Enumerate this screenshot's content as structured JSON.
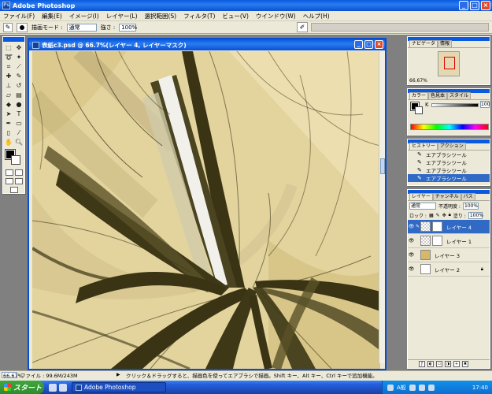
{
  "window": {
    "title": "Adobe Photoshop"
  },
  "menu": [
    "ファイル(F)",
    "編集(E)",
    "イメージ(I)",
    "レイヤー(L)",
    "選択範囲(S)",
    "フィルタ(T)",
    "ビュー(V)",
    "ウインドウ(W)",
    "ヘルプ(H)"
  ],
  "options": {
    "mode_label": "描画モード :",
    "mode_value": "通常",
    "strength_label": "強さ :",
    "strength_value": "100%"
  },
  "document": {
    "title": "表紙c3.psd @ 66.7%(レイヤー 4, レイヤーマスク)"
  },
  "navigator": {
    "tabs": [
      "ナビゲータ",
      "情報"
    ],
    "zoom": "66.67%"
  },
  "color": {
    "tabs": [
      "カラー",
      "色見本",
      "スタイル"
    ],
    "channel_label": "K",
    "k_value": "100"
  },
  "history": {
    "tabs": [
      "ヒストリー",
      "アクション"
    ],
    "items": [
      {
        "label": "エアブラシツール"
      },
      {
        "label": "エアブラシツール"
      },
      {
        "label": "エアブラシツール"
      },
      {
        "label": "エアブラシツール"
      }
    ]
  },
  "layers": {
    "tabs": [
      "レイヤー",
      "チャンネル",
      "パス"
    ],
    "blend": "通常",
    "opacity_label": "不透明度 :",
    "opacity": "100%",
    "lock_label": "ロック :",
    "fill_label": "塗り :",
    "fill": "100%",
    "items": [
      {
        "name": "レイヤー 4"
      },
      {
        "name": "レイヤー 1"
      },
      {
        "name": "レイヤー 3"
      },
      {
        "name": "レイヤー 2"
      }
    ]
  },
  "status": {
    "zoom": "66.67%",
    "file": "ファイル : 99.6M/243M",
    "hint": "クリック＆ドラッグすると、描画色を使ってエアブラシで描画。Shift キー、Alt キー、Ctrl キーで追加機能。"
  },
  "taskbar": {
    "start": "スタート",
    "task": "Adobe Photoshop",
    "tray_text": "A般",
    "clock": "17:40"
  },
  "colors": {
    "canvas": "#e3d49e",
    "stroke": "#3a3415",
    "xp_blue": "#0a5ae0"
  }
}
